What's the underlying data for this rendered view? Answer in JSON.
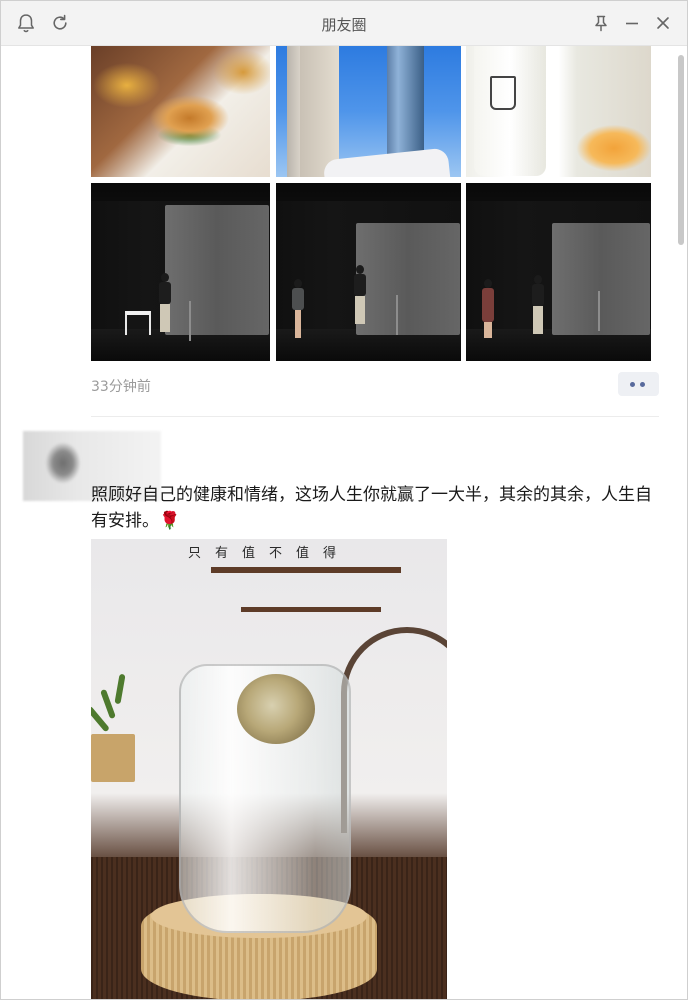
{
  "window": {
    "title": "朋友圈",
    "icons": [
      "bell-icon",
      "refresh-icon",
      "pin-icon",
      "minimize-icon",
      "close-icon"
    ]
  },
  "post1": {
    "photos": [
      "burger-fries-photo",
      "skyscraper-photo",
      "coffee-cup-photo",
      "stage-photo-1",
      "stage-photo-2",
      "stage-photo-3"
    ],
    "timestamp": "33分钟前"
  },
  "post2": {
    "text": "照顾好自己的健康和情绪，这场人生你就赢了一大半，其余的其余，人生自有安排。",
    "emoji": "🌹",
    "image_caption": "只有值不值得"
  },
  "colors": {
    "more_dots": "#586a9c",
    "more_bg": "#eef0f4",
    "timestamp": "#9b9b9b"
  }
}
